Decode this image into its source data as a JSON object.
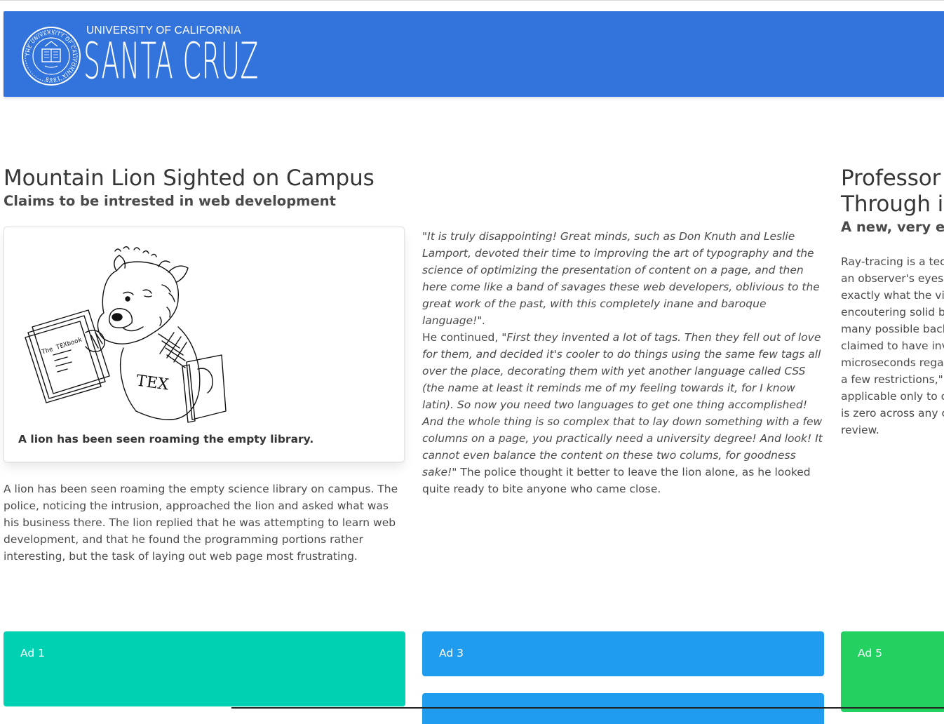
{
  "header": {
    "university": "UNIVERSITY OF CALIFORNIA",
    "campus": "SANTA CRUZ",
    "seal_text": "THE UNIVERSITY OF CALIFORNIA 1868",
    "brand_color": "#3273dc"
  },
  "article1": {
    "title": "Mountain Lion Sighted on Campus",
    "subtitle": "Claims to be intrested in web development",
    "figure_caption": "A lion has been seen roaming the empty library.",
    "figure_book_text": "The TEXbook",
    "figure_chest_text": "TEX",
    "body": "A lion has been seen roaming the empty science library on campus. The police, noticing the intrusion, approached the lion and asked what was his business there. The lion replied that he was attempting to learn web development, and that he found the programming portions rather interesting, but the task of laying out web page most frustrating.",
    "quote1": "\"It is truly disappointing! Great minds, such as Don Knuth and Leslie Lamport, devoted their time to improving the art of typography and the science of optimizing the presentation of content on a page, and then here come like a band of savages these web developers, oblivious to the great work of the past, with this completely inane and baroque language!\".",
    "continued_lead": "He continued, ",
    "quote2": "\"First they invented a lot of tags. Then they fell out of love for them, and decided it's cooler to do things using the same few tags all over the place, decorating them with yet another language called CSS (the name at least it reminds me of my feeling towards it, for I know latin). So now you need two languages to get one thing accomplished! And the whole thing is so complex that to lay down something with a few columns on a page, you practically need a university degree! And look! It cannot even balance the content on these two colums, for goodness sake!\"",
    "ending": " The police thought it better to leave the lion alone, as he looked quite ready to bite anyone who came close."
  },
  "article2": {
    "title_line1": "Professor c",
    "title_line2": "Through in",
    "subtitle": "A new, very effici",
    "body_lines": [
      "Ray-tracing is a techn",
      "an observer's eyes ar",
      "exactly what the view",
      "encoutering solid bo",
      "many possible backw",
      "claimed to have inver",
      "microseconds regard",
      "a few restrictions,\" he",
      "applicable only to clo",
      "is zero across any clo",
      "review."
    ]
  },
  "ads": [
    {
      "label": "Ad 1",
      "color": "#00d1b2"
    },
    {
      "label": "Ad 3",
      "color": "#209cee"
    },
    {
      "label": "Ad 5",
      "color": "#23d160"
    }
  ]
}
